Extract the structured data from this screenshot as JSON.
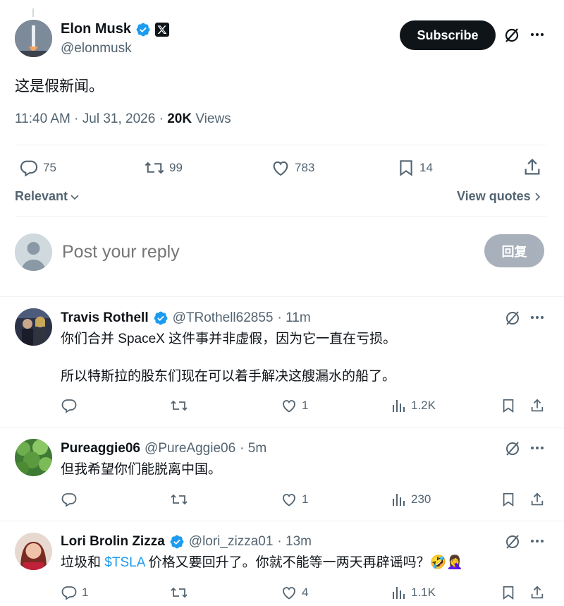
{
  "tweet": {
    "author_name": "Elon Musk",
    "author_handle": "@elonmusk",
    "text": "这是假新闻。",
    "time": "11:40 AM",
    "date": "Jul 31, 2026",
    "views_count": "20K",
    "views_label": "Views",
    "subscribe_label": "Subscribe",
    "stats": {
      "replies": "75",
      "reposts": "99",
      "likes": "783",
      "bookmarks": "14"
    }
  },
  "sort": {
    "label": "Relevant",
    "view_quotes": "View quotes"
  },
  "composer": {
    "placeholder": "Post your reply",
    "button": "回复"
  },
  "replies": [
    {
      "name": "Travis Rothell",
      "handle": "@TRothell62855",
      "time": "· 11m",
      "line1": "你们合并 SpaceX 这件事并非虚假，因为它一直在亏损。",
      "line2": "所以特斯拉的股东们现在可以着手解决这艘漏水的船了。",
      "replies": "",
      "reposts": "",
      "likes": "1",
      "views": "1.2K"
    },
    {
      "name": "Pureaggie06",
      "handle": "@PureAggie06",
      "time": "· 5m",
      "line1": "但我希望你们能脱离中国。",
      "replies": "",
      "reposts": "",
      "likes": "1",
      "views": "230"
    },
    {
      "name": "Lori Brolin Zizza",
      "handle": "@lori_zizza01",
      "time": "· 13m",
      "line1_a": "垃圾和 ",
      "line1_link": "$TSLA",
      "line1_b": " 价格又要回升了。你就不能等一两天再辟谣吗？🤣🤦‍♀️",
      "replies": "1",
      "reposts": "",
      "likes": "4",
      "views": "1.1K"
    }
  ],
  "colors": {
    "verified": "#1d9bf0",
    "link": "#1d9bf0",
    "text": "#0f1419",
    "muted": "#536471"
  }
}
